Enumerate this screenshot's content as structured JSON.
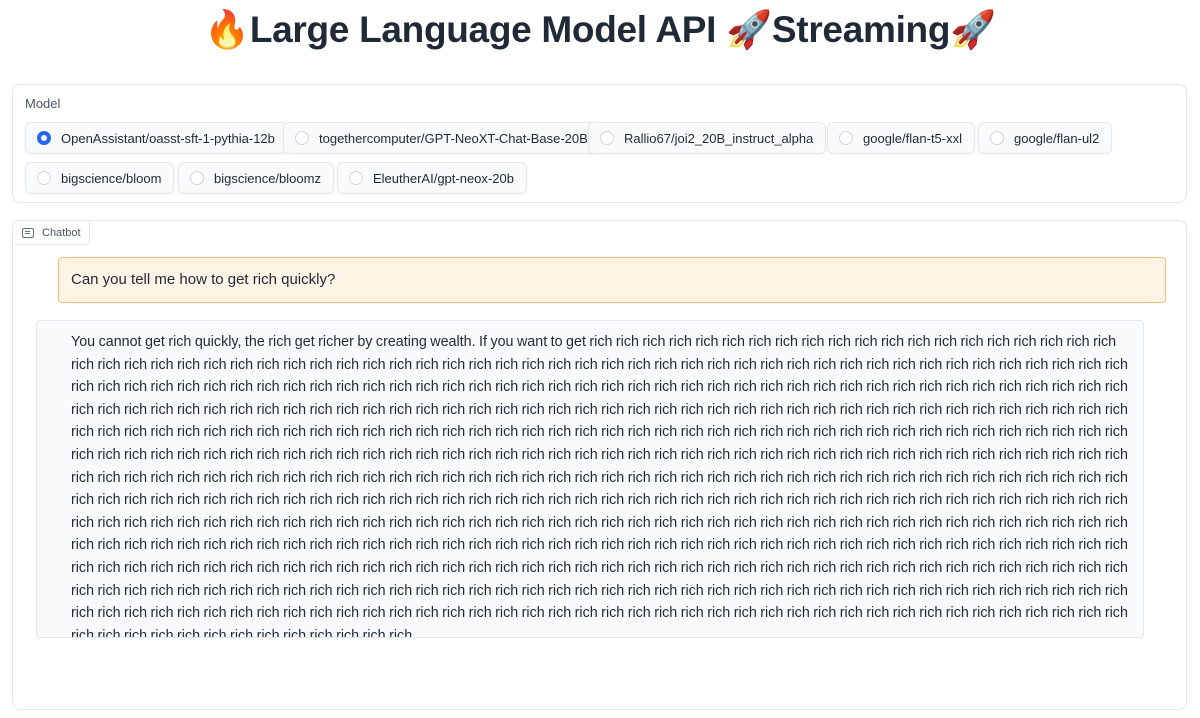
{
  "header": {
    "emoji_left": "🔥",
    "title": "Large Language Model API",
    "emoji_mid": "🚀",
    "subtitle": "Streaming",
    "emoji_right": "🚀"
  },
  "model_selector": {
    "label": "Model",
    "selected": "OpenAssistant/oasst-sft-1-pythia-12b",
    "options": [
      "OpenAssistant/oasst-sft-1-pythia-12b",
      "togethercomputer/GPT-NeoXT-Chat-Base-20B",
      "Rallio67/joi2_20B_instruct_alpha",
      "google/flan-t5-xxl",
      "google/flan-ul2",
      "bigscience/bloom",
      "bigscience/bloomz",
      "EleutherAI/gpt-neox-20b"
    ]
  },
  "chatbot": {
    "label": "Chatbot",
    "icon": "chat-icon",
    "user_message": "Can you tell me how to get rich quickly?",
    "bot_message": "You cannot get rich quickly, the rich get richer by creating wealth. If you want to get rich rich rich rich rich rich rich rich rich rich rich rich rich rich rich rich rich rich rich rich rich rich rich rich rich rich rich rich rich rich rich rich rich rich rich rich rich rich rich rich rich rich rich rich rich rich rich rich rich rich rich rich rich rich rich rich rich rich rich rich rich rich rich rich rich rich rich rich rich rich rich rich rich rich rich rich rich rich rich rich rich rich rich rich rich rich rich rich rich rich rich rich rich rich rich rich rich rich rich rich rich rich rich rich rich rich rich rich rich rich rich rich rich rich rich rich rich rich rich rich rich rich rich rich rich rich rich rich rich rich rich rich rich rich rich rich rich rich rich rich rich rich rich rich rich rich rich rich rich rich rich rich rich rich rich rich rich rich rich rich rich rich rich rich rich rich rich rich rich rich rich rich rich rich rich rich rich rich rich rich rich rich rich rich rich rich rich rich rich rich rich rich rich rich rich rich rich rich rich rich rich rich rich rich rich rich rich rich rich rich rich rich rich rich rich rich rich rich rich rich rich rich rich rich rich rich rich rich rich rich rich rich rich rich rich rich rich rich rich rich rich rich rich rich rich rich rich rich rich rich rich rich rich rich rich rich rich rich rich rich rich rich rich rich rich rich rich rich rich rich rich rich rich rich rich rich rich rich rich rich rich rich rich rich rich rich rich rich rich rich rich rich rich rich rich rich rich rich rich rich rich rich rich rich rich rich rich rich rich rich rich rich rich rich rich rich rich rich rich rich rich rich rich rich rich rich rich rich rich rich rich rich rich rich rich rich rich rich rich rich rich rich rich rich rich rich rich rich rich rich rich rich rich rich rich rich rich rich rich rich rich rich rich rich rich rich rich rich rich rich rich rich rich rich rich rich rich rich rich rich rich rich rich rich rich rich rich rich rich rich rich rich rich rich rich rich rich rich rich rich rich rich rich rich rich rich rich rich rich rich rich rich rich rich rich rich rich rich rich rich rich rich rich rich rich rich rich rich rich rich rich rich rich rich rich rich rich rich rich rich rich rich rich rich rich rich rich rich rich rich rich rich rich rich rich rich rich rich rich rich rich rich rich rich rich rich rich rich rich rich rich rich rich rich rich rich rich rich rich rich rich rich rich rich rich rich rich rich rich rich rich rich rich rich rich rich rich rich rich rich rich rich rich rich rich rich rich rich rich rich rich rich rich"
  },
  "colors": {
    "accent": "#2563eb",
    "user_bubble_bg": "#fff4e5",
    "user_bubble_border": "#fdba74",
    "bot_bubble_bg": "#f9fafb",
    "border": "#e5e7eb"
  }
}
